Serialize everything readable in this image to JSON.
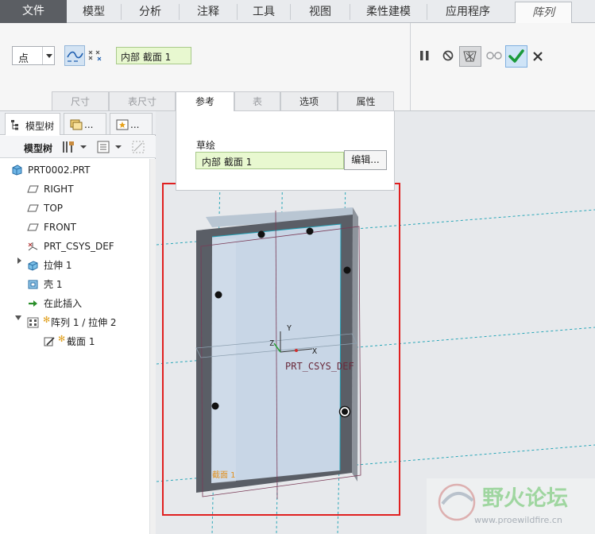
{
  "menubar": {
    "tabs": [
      {
        "label": "文件"
      },
      {
        "label": "模型"
      },
      {
        "label": "分析"
      },
      {
        "label": "注释"
      },
      {
        "label": "工具"
      },
      {
        "label": "视图"
      },
      {
        "label": "柔性建模"
      },
      {
        "label": "应用程序"
      },
      {
        "label": "阵列"
      }
    ]
  },
  "ribbon": {
    "pattern_type": "点",
    "reference": "内部 截面 1",
    "subtabs": [
      {
        "label": "尺寸"
      },
      {
        "label": "表尺寸"
      },
      {
        "label": "参考"
      },
      {
        "label": "表"
      },
      {
        "label": "选项"
      },
      {
        "label": "属性"
      }
    ],
    "active_subtab": "参考",
    "icons": [
      "pause-icon",
      "no-preview-icon",
      "verify-icon",
      "glasses-icon",
      "checkmark-icon",
      "close-icon"
    ]
  },
  "sidebar": {
    "tabs": [
      {
        "label": "模型树"
      },
      {
        "label": "..."
      },
      {
        "label": "..."
      }
    ],
    "toolbar_label": "模型树",
    "tree": [
      {
        "label": "PRT0002.PRT",
        "icon": "part-icon"
      },
      {
        "label": "RIGHT",
        "icon": "datum-plane-icon"
      },
      {
        "label": "TOP",
        "icon": "datum-plane-icon"
      },
      {
        "label": "FRONT",
        "icon": "datum-plane-icon"
      },
      {
        "label": "PRT_CSYS_DEF",
        "icon": "csys-icon"
      },
      {
        "label": "拉伸 1",
        "icon": "extrude-icon"
      },
      {
        "label": "壳 1",
        "icon": "shell-icon"
      },
      {
        "label": "在此插入",
        "icon": "insert-arrow-icon"
      },
      {
        "label": "阵列 1 / 拉伸 2",
        "icon": "pattern-icon"
      },
      {
        "label": "截面 1",
        "icon": "sketch-icon"
      }
    ]
  },
  "sketch_panel": {
    "heading": "草绘",
    "section_value": "内部 截面 1",
    "edit_button": "编辑..."
  },
  "viewport": {
    "csys_label": "PRT_CSYS_DEF",
    "axis_y": "Y",
    "axis_z": "Z",
    "axis_x": "X",
    "sketch_tag": "截面 1",
    "watermark_title": "野火论坛",
    "watermark_url": "www.proewildfire.cn",
    "highlight_color": "#e02020"
  }
}
